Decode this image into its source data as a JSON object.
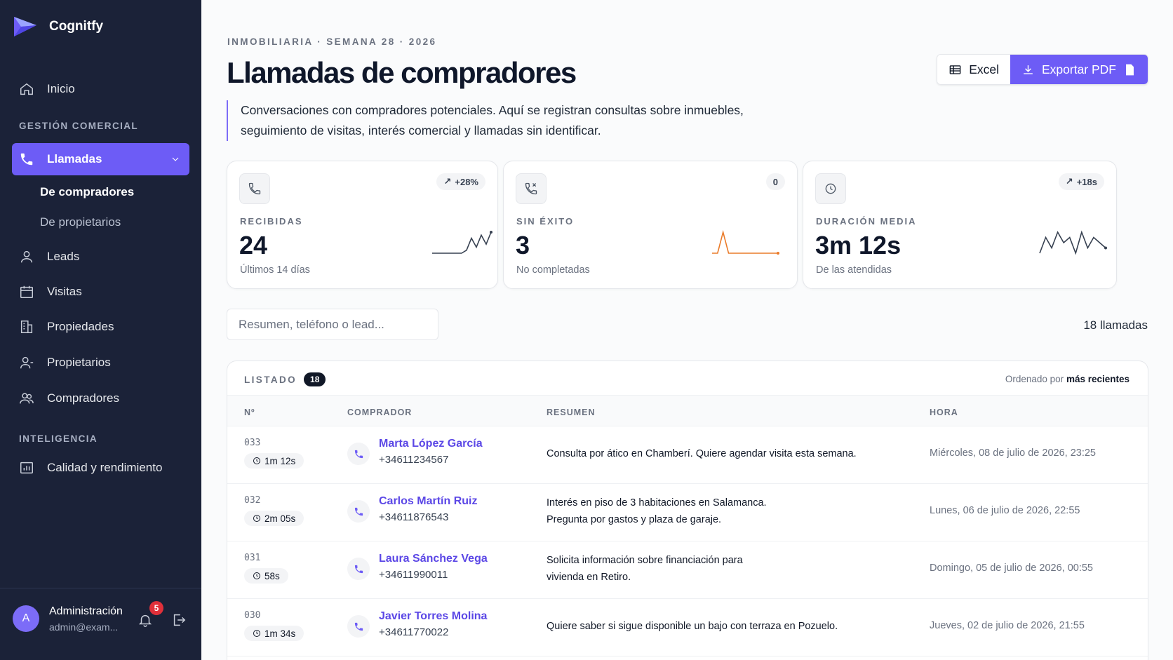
{
  "app": {
    "name": "Cognitfy"
  },
  "sidebar": {
    "home": "Inicio",
    "section_commercial": "GESTIÓN COMERCIAL",
    "calls": "Llamadas",
    "sub_buyers": "De compradores",
    "sub_owners": "De propietarios",
    "leads": "Leads",
    "visits": "Visitas",
    "properties": "Propiedades",
    "owners": "Propietarios",
    "buyers": "Compradores",
    "section_intel": "INTELIGENCIA",
    "quality": "Calidad y rendimiento"
  },
  "user": {
    "initial": "A",
    "name": "Administración",
    "email": "admin@exam...",
    "notifications": "5"
  },
  "header": {
    "eyebrow": "INMOBILIARIA · SEMANA 28 · 2026",
    "title": "Llamadas de compradores",
    "description": "Conversaciones con compradores potenciales. Aquí se registran consultas sobre inmuebles, seguimiento de visitas, interés comercial y llamadas sin identificar.",
    "excel": "Excel",
    "pdf": "Exportar PDF"
  },
  "cards": [
    {
      "label": "RECIBIDAS",
      "value": "24",
      "sub": "Últimos 14 días",
      "delta": "+28%",
      "spark": [
        0,
        0,
        0,
        0,
        0,
        0,
        0,
        1,
        5,
        2,
        6,
        3,
        7
      ],
      "color": "#374151"
    },
    {
      "label": "SIN ÉXITO",
      "value": "3",
      "sub": "No completadas",
      "delta": "0",
      "spark": [
        0,
        0,
        6,
        0,
        0,
        0,
        0,
        0,
        0,
        0,
        0,
        0,
        0
      ],
      "color": "#ea7b2a"
    },
    {
      "label": "DURACIÓN MEDIA",
      "value": "3m 12s",
      "sub": "De las atendidas",
      "delta": "+18s",
      "spark": [
        0,
        3,
        1,
        4,
        2,
        3,
        0,
        4,
        1,
        3,
        2,
        1
      ],
      "color": "#374151"
    }
  ],
  "search": {
    "placeholder": "Resumen, teléfono o lead..."
  },
  "count_label": "18 llamadas",
  "list": {
    "title": "LISTADO",
    "count": "18",
    "sort_prefix": "Ordenado por",
    "sort_value": "más recientes",
    "columns": [
      "Nº",
      "COMPRADOR",
      "RESUMEN",
      "HORA"
    ],
    "rows": [
      {
        "num": "033",
        "dur": "1m 12s",
        "name": "Marta López García",
        "phone": "+34611234567",
        "summary": [
          "Consulta por ático en Chamberí. Quiere agendar visita esta semana."
        ],
        "time": "Miércoles, 08 de julio de 2026, 23:25"
      },
      {
        "num": "032",
        "dur": "2m 05s",
        "name": "Carlos Martín Ruiz",
        "phone": "+34611876543",
        "summary": [
          "Interés en piso de 3 habitaciones en Salamanca.",
          "Pregunta por gastos y plaza de garaje."
        ],
        "time": "Lunes, 06 de julio de 2026, 22:55"
      },
      {
        "num": "031",
        "dur": "58s",
        "name": "Laura Sánchez Vega",
        "phone": "+34611990011",
        "summary": [
          "Solicita información sobre financiación para",
          "vivienda en Retiro."
        ],
        "time": "Domingo, 05 de julio de 2026, 00:55"
      },
      {
        "num": "030",
        "dur": "1m 34s",
        "name": "Javier Torres Molina",
        "phone": "+34611770022",
        "summary": [
          "Quiere saber si sigue disponible un bajo con terraza en Pozuelo."
        ],
        "time": "Jueves, 02 de julio de 2026, 21:55"
      }
    ]
  }
}
